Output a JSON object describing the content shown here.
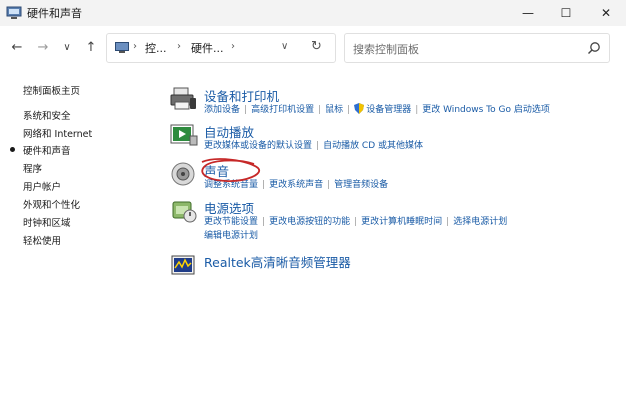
{
  "window": {
    "title": "硬件和声音",
    "controls": {
      "minimize": "—",
      "maximize": "☐",
      "close": "✕"
    }
  },
  "nav": {
    "back": "←",
    "forward": "→",
    "recent": "∨",
    "up": "↑",
    "breadcrumbs": [
      "控...",
      "硬件..."
    ],
    "refresh": "↻",
    "search_placeholder": "搜索控制面板"
  },
  "sidebar": {
    "items": [
      {
        "label": "控制面板主页",
        "active": false
      },
      {
        "label": "系统和安全",
        "active": false
      },
      {
        "label": "网络和 Internet",
        "active": false
      },
      {
        "label": "硬件和声音",
        "active": true
      },
      {
        "label": "程序",
        "active": false
      },
      {
        "label": "用户帐户",
        "active": false
      },
      {
        "label": "外观和个性化",
        "active": false
      },
      {
        "label": "时钟和区域",
        "active": false
      },
      {
        "label": "轻松使用",
        "active": false
      }
    ]
  },
  "categories": [
    {
      "title": "设备和打印机",
      "icon": "printer-icon",
      "lines": [
        [
          "添加设备",
          "高级打印机设置",
          "鼠标",
          "设备管理器",
          "更改 Windows To Go 启动选项"
        ]
      ]
    },
    {
      "title": "自动播放",
      "icon": "autoplay-icon",
      "lines": [
        [
          "更改媒体或设备的默认设置",
          "自动播放 CD 或其他媒体"
        ]
      ]
    },
    {
      "title": "声音",
      "icon": "speaker-icon",
      "lines": [
        [
          "调整系统音量",
          "更改系统声音",
          "管理音频设备"
        ]
      ]
    },
    {
      "title": "电源选项",
      "icon": "power-options-icon",
      "lines": [
        [
          "更改节能设置",
          "更改电源按钮的功能",
          "更改计算机睡眠时间",
          "选择电源计划"
        ],
        [
          "编辑电源计划"
        ]
      ]
    },
    {
      "title": "Realtek高清晰音频管理器",
      "icon": "realtek-audio-icon",
      "lines": []
    }
  ],
  "colors": {
    "link": "#1a5ba6",
    "annotation": "#c62828"
  }
}
